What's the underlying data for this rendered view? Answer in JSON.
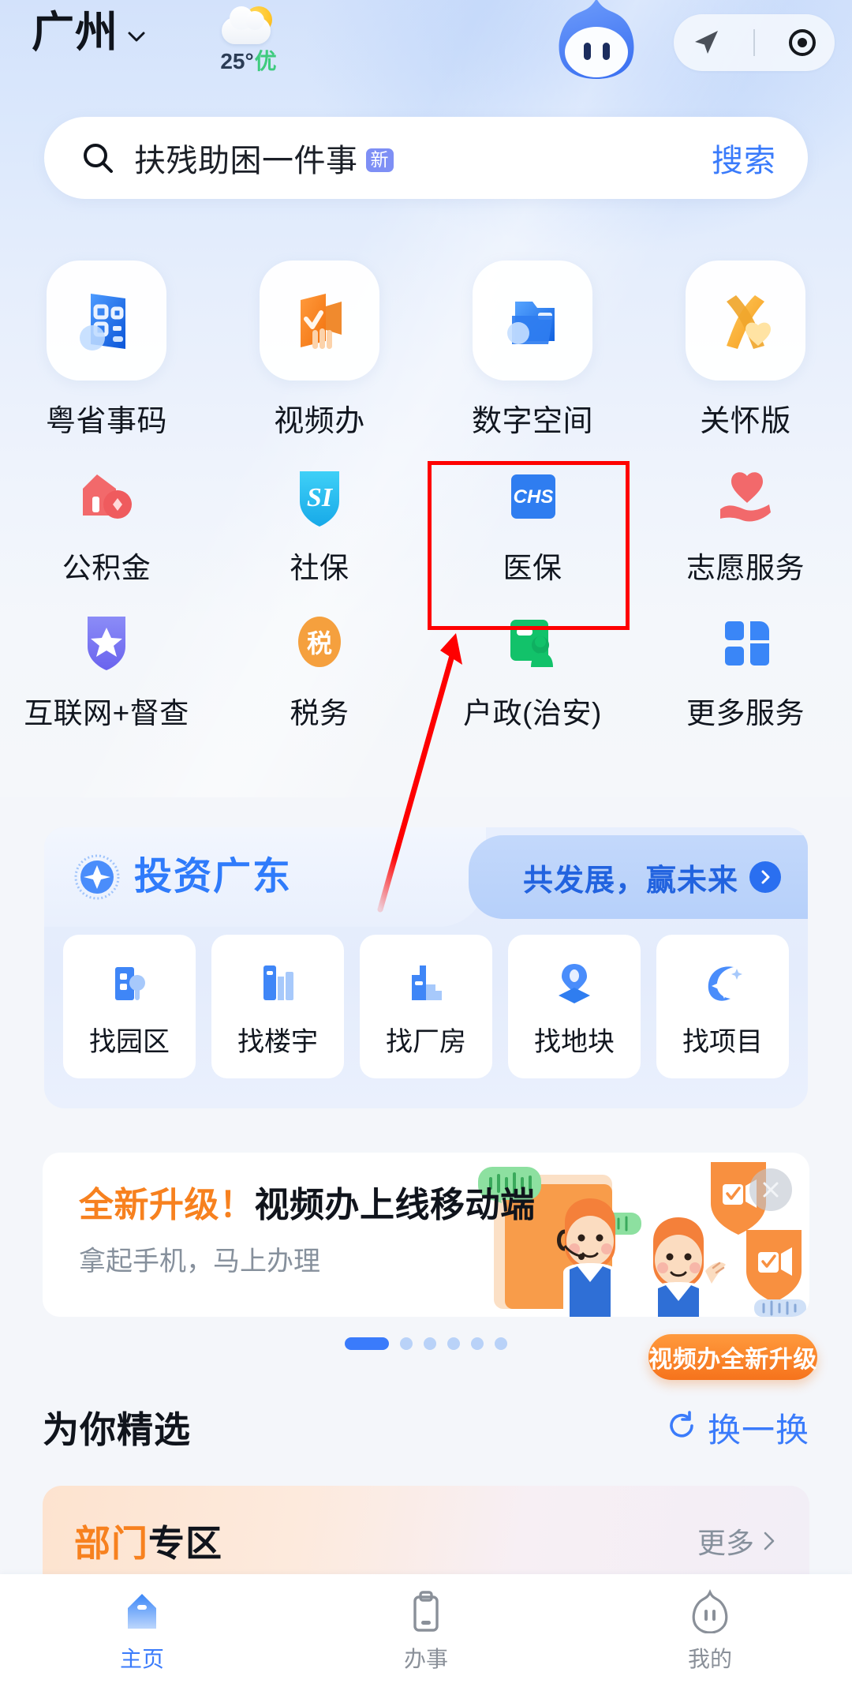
{
  "header": {
    "city": "广州",
    "weather": {
      "temp": "25°",
      "aqi": "优",
      "icon": "sun-behind-cloud-icon"
    },
    "mascot": "app-mascot-icon",
    "capsule": {
      "locate": "navigation-arrow-icon",
      "menu": "target-circle-icon"
    }
  },
  "search": {
    "icon": "search-icon",
    "keyword": "扶残助困一件事",
    "badge": "新",
    "button": "搜索"
  },
  "grid": {
    "row1": [
      {
        "label": "粤省事码",
        "icon": "qr-card-icon"
      },
      {
        "label": "视频办",
        "icon": "video-check-icon"
      },
      {
        "label": "数字空间",
        "icon": "digital-folder-icon"
      },
      {
        "label": "关怀版",
        "icon": "ribbon-heart-icon"
      }
    ],
    "row2": [
      {
        "label": "公积金",
        "icon": "house-fund-icon"
      },
      {
        "label": "社保",
        "icon": "si-shield-icon"
      },
      {
        "label": "医保",
        "icon": "chs-card-icon",
        "highlighted": true
      },
      {
        "label": "志愿服务",
        "icon": "heart-hand-icon"
      }
    ],
    "row3": [
      {
        "label": "互联网+督查",
        "icon": "star-shield-icon"
      },
      {
        "label": "税务",
        "icon": "tax-oval-icon"
      },
      {
        "label": "户政(治安)",
        "icon": "id-card-person-icon"
      },
      {
        "label": "更多服务",
        "icon": "grid-more-icon"
      }
    ]
  },
  "invest": {
    "title": "投资广东",
    "logo": "invest-swirl-icon",
    "tagline": "共发展，赢未来",
    "tag_arrow": "chevron-right-icon",
    "items": [
      {
        "label": "找园区",
        "icon": "park-building-icon"
      },
      {
        "label": "找楼宇",
        "icon": "tower-building-icon"
      },
      {
        "label": "找厂房",
        "icon": "factory-icon"
      },
      {
        "label": "找地块",
        "icon": "land-pin-icon"
      },
      {
        "label": "找项目",
        "icon": "project-spark-icon"
      }
    ]
  },
  "promo": {
    "title_highlight": "全新升级！",
    "title_rest": "视频办上线移动端",
    "subtitle": "拿起手机，马上办理",
    "close": "close-icon",
    "pill": "视频办全新升级",
    "dots_total": 6,
    "dots_active": 1
  },
  "foryou": {
    "title": "为你精选",
    "refresh_icon": "refresh-icon",
    "refresh_label": "换一换"
  },
  "dept": {
    "title_highlight": "部门",
    "title_rest": "专区",
    "more": "更多",
    "more_icon": "chevron-right-icon"
  },
  "tabbar": {
    "tabs": [
      {
        "label": "主页",
        "icon": "home-icon",
        "active": true
      },
      {
        "label": "办事",
        "icon": "clipboard-icon",
        "active": false
      },
      {
        "label": "我的",
        "icon": "profile-mascot-icon",
        "active": false
      }
    ]
  },
  "annotation": {
    "highlight_box_color": "#fe0000",
    "arrow_color": "#fe0000",
    "target": "医保"
  },
  "colors": {
    "brand_blue": "#3a7bfb",
    "orange": "#f7811f",
    "green": "#3ecb7e",
    "bg": "#f4f6fa"
  }
}
